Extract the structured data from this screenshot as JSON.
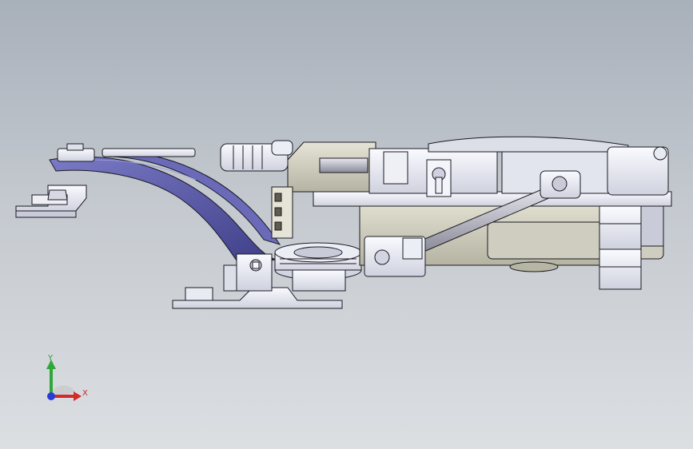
{
  "viewport": {
    "background_top": "#a8b0ba",
    "background_bottom": "#dcdfe2"
  },
  "model": {
    "description_icon": "cad-assembly-icon",
    "colors": {
      "metal_light": "#f2f3f8",
      "metal_shade": "#c8cad8",
      "edge": "#1a1a22",
      "blade": "#5a5aa8",
      "blade_dark": "#3c3c80",
      "housing": "#d8d6c8",
      "housing_shade": "#b9b7a6"
    }
  },
  "triad": {
    "x_label": "X",
    "y_label": "Y",
    "x_color": "#d42a2a",
    "y_color": "#2fa83a",
    "z_color": "#2a3ad4"
  }
}
